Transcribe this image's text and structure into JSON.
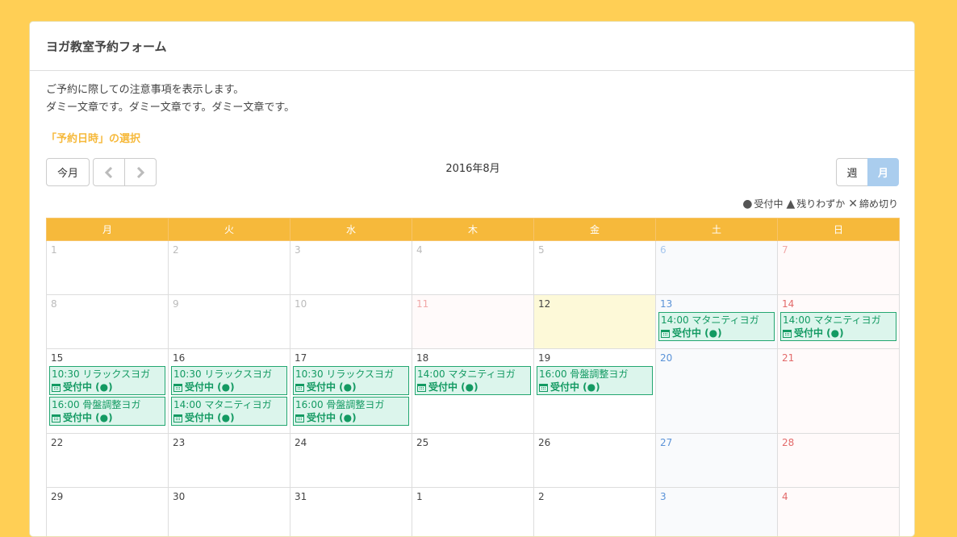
{
  "header": {
    "title": "ヨガ教室予約フォーム"
  },
  "notice": {
    "line1": "ご予約に際しての注意事項を表示します。",
    "line2": "ダミー文章です。ダミー文章です。ダミー文章です。"
  },
  "section_label": "「予約日時」の選択",
  "toolbar": {
    "today_label": "今月",
    "month_title": "2016年8月",
    "week_label": "週",
    "month_label": "月"
  },
  "legend": [
    {
      "icon": "circle-icon",
      "symbol": "●",
      "label": "受付中"
    },
    {
      "icon": "triangle-icon",
      "symbol": "▲",
      "label": "残りわずか"
    },
    {
      "icon": "cross-icon",
      "symbol": "✕",
      "label": "締め切り"
    }
  ],
  "weekdays": [
    "月",
    "火",
    "水",
    "木",
    "金",
    "土",
    "日"
  ],
  "colors": {
    "background": "#ffcf55",
    "header": "#f6b93b",
    "event_bg": "#dcf5ec",
    "event_border": "#23a670",
    "active_view": "#aacdee"
  },
  "weeks": [
    [
      {
        "day": "1",
        "past": true
      },
      {
        "day": "2",
        "past": true
      },
      {
        "day": "3",
        "past": true
      },
      {
        "day": "4",
        "past": true
      },
      {
        "day": "5",
        "past": true
      },
      {
        "day": "6",
        "past": true,
        "kind": "sat"
      },
      {
        "day": "7",
        "past": true,
        "kind": "sun"
      }
    ],
    [
      {
        "day": "8",
        "past": true
      },
      {
        "day": "9",
        "past": true
      },
      {
        "day": "10",
        "past": true
      },
      {
        "day": "11",
        "past": true,
        "kind": "hol"
      },
      {
        "day": "12",
        "kind": "today"
      },
      {
        "day": "13",
        "kind": "sat",
        "events": [
          {
            "time_title": "14:00 マタニティヨガ",
            "status": "受付中 (●)"
          }
        ]
      },
      {
        "day": "14",
        "kind": "sun",
        "events": [
          {
            "time_title": "14:00 マタニティヨガ",
            "status": "受付中 (●)"
          }
        ]
      }
    ],
    [
      {
        "day": "15",
        "events": [
          {
            "time_title": "10:30 リラックスヨガ",
            "status": "受付中 (●)"
          },
          {
            "time_title": "16:00 骨盤調整ヨガ",
            "status": "受付中 (●)"
          }
        ]
      },
      {
        "day": "16",
        "events": [
          {
            "time_title": "10:30 リラックスヨガ",
            "status": "受付中 (●)"
          },
          {
            "time_title": "14:00 マタニティヨガ",
            "status": "受付中 (●)"
          }
        ]
      },
      {
        "day": "17",
        "events": [
          {
            "time_title": "10:30 リラックスヨガ",
            "status": "受付中 (●)"
          },
          {
            "time_title": "16:00 骨盤調整ヨガ",
            "status": "受付中 (●)"
          }
        ]
      },
      {
        "day": "18",
        "events": [
          {
            "time_title": "14:00 マタニティヨガ",
            "status": "受付中 (●)"
          }
        ]
      },
      {
        "day": "19",
        "events": [
          {
            "time_title": "16:00 骨盤調整ヨガ",
            "status": "受付中 (●)"
          }
        ]
      },
      {
        "day": "20",
        "kind": "sat"
      },
      {
        "day": "21",
        "kind": "sun"
      }
    ],
    [
      {
        "day": "22"
      },
      {
        "day": "23"
      },
      {
        "day": "24"
      },
      {
        "day": "25"
      },
      {
        "day": "26"
      },
      {
        "day": "27",
        "kind": "sat"
      },
      {
        "day": "28",
        "kind": "sun"
      }
    ],
    [
      {
        "day": "29"
      },
      {
        "day": "30"
      },
      {
        "day": "31"
      },
      {
        "day": "1"
      },
      {
        "day": "2"
      },
      {
        "day": "3",
        "kind": "sat"
      },
      {
        "day": "4",
        "kind": "sun"
      }
    ]
  ]
}
